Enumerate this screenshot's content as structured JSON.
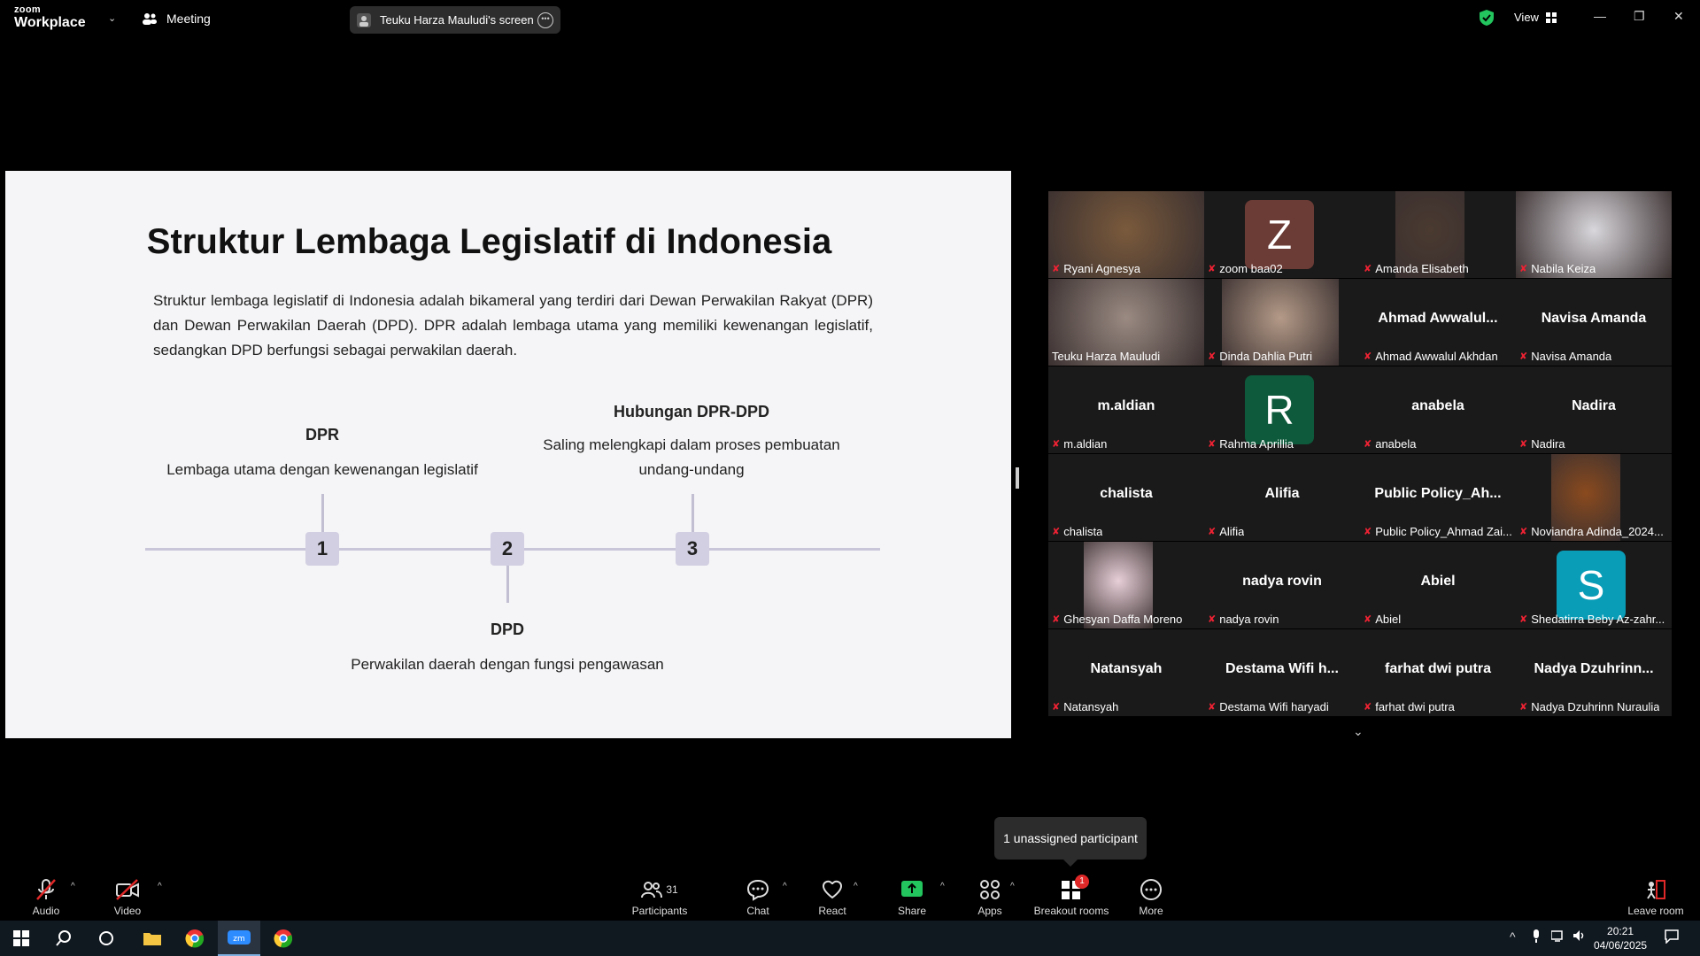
{
  "app": {
    "brand_line1": "zoom",
    "brand_line2": "Workplace",
    "meeting_label": "Meeting",
    "screen_share_label": "Teuku Harza Mauludi's screen",
    "view_label": "View"
  },
  "slide": {
    "title": "Struktur Lembaga Legislatif di Indonesia",
    "paragraph": "Struktur lembaga legislatif di Indonesia adalah bikameral yang terdiri dari Dewan Perwakilan Rakyat (DPR) dan Dewan Perwakilan Daerah (DPD). DPR adalah lembaga utama yang memiliki kewenangan legislatif, sedangkan DPD berfungsi sebagai perwakilan daerah.",
    "steps": [
      {
        "num": "1",
        "head": "DPR",
        "desc": "Lembaga utama dengan kewenangan legislatif"
      },
      {
        "num": "2",
        "head": "DPD",
        "desc": "Perwakilan daerah dengan fungsi pengawasan"
      },
      {
        "num": "3",
        "head": "Hubungan DPR-DPD",
        "desc": "Saling melengkapi dalam proses pembuatan undang-undang"
      }
    ]
  },
  "participants": [
    {
      "name": "Ryani Agnesya",
      "type": "photo",
      "color": "#7a5a3c"
    },
    {
      "name": "zoom baa02",
      "type": "letter",
      "letter": "Z",
      "color": "#6b3b35"
    },
    {
      "name": "Amanda Elisabeth",
      "type": "photo",
      "color": "#4a3a30"
    },
    {
      "name": "Nabila Keiza",
      "type": "photo",
      "color": "#d9d7dc"
    },
    {
      "name": "Teuku Harza Mauludi",
      "type": "photo",
      "color": "#9a8a82",
      "active": true
    },
    {
      "name": "Dinda Dahlia Putri",
      "type": "photo",
      "color": "#b49a88"
    },
    {
      "name": "Ahmad Awwalul Akhdan",
      "big": "Ahmad  Awwalul...",
      "type": "text"
    },
    {
      "name": "Navisa Amanda",
      "big": "Navisa Amanda",
      "type": "text"
    },
    {
      "name": "m.aldian",
      "big": "m.aldian",
      "type": "text"
    },
    {
      "name": "Rahma Aprillia",
      "type": "letter",
      "letter": "R",
      "color": "#0d5a3c"
    },
    {
      "name": "anabela",
      "big": "anabela",
      "type": "text"
    },
    {
      "name": "Nadira",
      "big": "Nadira",
      "type": "text"
    },
    {
      "name": "chalista",
      "big": "chalista",
      "type": "text"
    },
    {
      "name": "Alifia",
      "big": "Alifia",
      "type": "text"
    },
    {
      "name": "Public Policy_Ahmad Zai...",
      "big": "Public  Policy_Ah...",
      "type": "text"
    },
    {
      "name": "Noviandra Adinda_2024...",
      "type": "photo",
      "color": "#8a4a1e"
    },
    {
      "name": "Ghesyan Daffa Moreno",
      "type": "photo",
      "color": "#e8cfd8"
    },
    {
      "name": "nadya rovin",
      "big": "nadya rovin",
      "type": "text"
    },
    {
      "name": "Abiel",
      "big": "Abiel",
      "type": "text"
    },
    {
      "name": "Shedatirra Beby Az-zahr...",
      "type": "letter",
      "letter": "S",
      "color": "#0a9db8"
    },
    {
      "name": "Natansyah",
      "big": "Natansyah",
      "type": "text"
    },
    {
      "name": "Destama Wifi haryadi",
      "big": "Destama Wifi h...",
      "type": "text"
    },
    {
      "name": "farhat dwi putra",
      "big": "farhat dwi putra",
      "type": "text"
    },
    {
      "name": "Nadya Dzuhrinn Nuraulia",
      "big": "Nadya  Dzuhrinn...",
      "type": "text"
    }
  ],
  "tooltip": "1 unassigned participant",
  "toolbar": {
    "audio": "Audio",
    "video": "Video",
    "participants": "Participants",
    "participants_count": "31",
    "chat": "Chat",
    "react": "React",
    "share": "Share",
    "apps": "Apps",
    "breakout": "Breakout rooms",
    "breakout_badge": "1",
    "more": "More",
    "leave": "Leave room"
  },
  "taskbar": {
    "time": "20:21",
    "date": "04/06/2025"
  },
  "colors": {
    "share_green": "#22c55e",
    "active_border": "#1fe07c",
    "muted_red": "#e02828"
  }
}
